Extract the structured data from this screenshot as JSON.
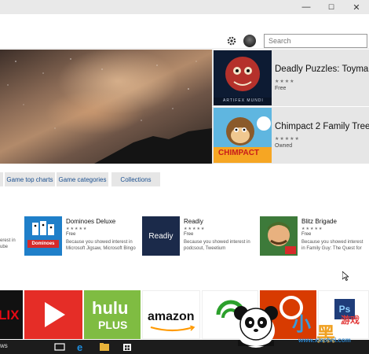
{
  "window": {
    "minimize": "—",
    "maximize": "☐",
    "close": "✕"
  },
  "header": {
    "search_placeholder": "Search"
  },
  "featured": [
    {
      "title": "Deadly Puzzles: Toymaker",
      "stars": "★★★★",
      "price": "Free",
      "thumb_caption": "ARTIFEX MUNDI"
    },
    {
      "title": "Chimpact 2 Family Tree",
      "stars": "★★★★★",
      "price": "Owned",
      "thumb_caption": "CHIMPACT"
    }
  ],
  "tabs": [
    "Game top charts",
    "Game categories",
    "Collections"
  ],
  "apps": [
    {
      "name": "Dominoes Deluxe",
      "stars": "★★★★★",
      "price": "Free",
      "desc": "Because you showed interest in Microsoft Jigsaw, Microsoft Bingo",
      "icon_text": "Dominoes"
    },
    {
      "name": "Readiy",
      "stars": "★★★★★",
      "price": "Free",
      "desc": "Because you showed interest in podcsout, Tweetium",
      "icon_text": "Readiy"
    },
    {
      "name": "Blitz Brigade",
      "stars": "★★★★★",
      "price": "Free",
      "desc": "Because you showed interest in Family Guy: The Quest for"
    }
  ],
  "cut_text": {
    "line1": "erest in",
    "line2": "ube"
  },
  "tiles": {
    "netflix": "LIX",
    "hulu1": "hulu",
    "hulu2": "PLUS",
    "amazon": "amazon",
    "ps": "Ps"
  },
  "taskbar": {
    "search_fragment": "ws"
  },
  "watermark": {
    "big1": "小",
    "big2": "黑",
    "url": "www.xiaohei.com",
    "small": "游戏"
  },
  "colors": {
    "accent": "#1a4f8f",
    "netflix": "#e50914",
    "youtube": "#e52d27",
    "hulu": "#7fbc42",
    "office": "#d83b01",
    "ps": "#1f3d7a"
  }
}
